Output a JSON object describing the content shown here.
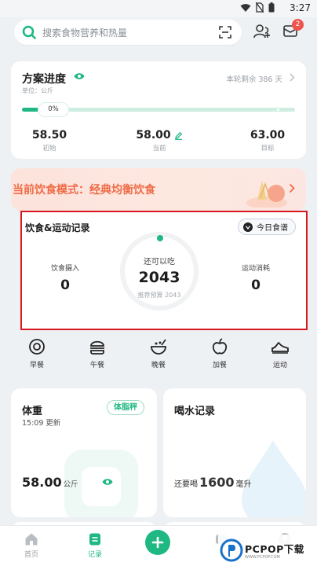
{
  "status_bar": {
    "time": "3:27"
  },
  "search": {
    "placeholder": "搜索食物营养和热量"
  },
  "header": {
    "mail_badge": "2"
  },
  "plan": {
    "title": "方案进度",
    "unit": "单位：公斤",
    "remaining": "本轮剩余 386 天",
    "progress_label": "0%",
    "progress_value": 0,
    "metrics": [
      {
        "value": "58.50",
        "label": "初始"
      },
      {
        "value": "58.00",
        "label": "当前"
      },
      {
        "value": "63.00",
        "label": "目标"
      }
    ]
  },
  "diet_mode": {
    "text": "当前饮食模式：经典均衡饮食"
  },
  "record": {
    "title": "饮食&运动记录",
    "today_button": "今日食谱",
    "intake_label": "饮食摄入",
    "intake_value": "0",
    "remaining_label": "还可以吃",
    "remaining_value": "2043",
    "budget_label": "推荐预算 2043",
    "burn_label": "运动消耗",
    "burn_value": "0"
  },
  "meals": [
    {
      "label": "早餐",
      "icon": "breakfast-icon"
    },
    {
      "label": "午餐",
      "icon": "lunch-icon"
    },
    {
      "label": "晚餐",
      "icon": "dinner-icon"
    },
    {
      "label": "加餐",
      "icon": "snack-icon"
    },
    {
      "label": "运动",
      "icon": "exercise-icon"
    }
  ],
  "weight": {
    "title": "体重",
    "updated": "15:09 更新",
    "bodyfat_button": "体脂秤",
    "value": "58.00",
    "unit": "公斤"
  },
  "water": {
    "title": "喝水记录",
    "need_prefix": "还要喝",
    "amount": "1600",
    "unit": "毫升"
  },
  "nav": {
    "home": "首页",
    "record": "记录"
  },
  "watermark": {
    "text": "PCPOP下载",
    "sub": "WWW.PCPOP.COM"
  },
  "colors": {
    "accent": "#1fb882",
    "diet_mode": "#ef6b47",
    "highlight_border": "#d9171f",
    "badge": "#f0524c"
  }
}
